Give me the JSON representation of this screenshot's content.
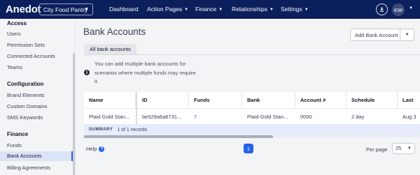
{
  "topbar": {
    "logo": "Anedot",
    "org_select": "City Food Pantry",
    "nav": [
      "Dashboard",
      "Action Pages",
      "Finance",
      "Relationships",
      "Settings"
    ],
    "avatar_initials": "KW"
  },
  "sidebar": {
    "sections": [
      {
        "heading": "Access",
        "items": [
          "Users",
          "Permission Sets",
          "Connected Accounts",
          "Teams"
        ]
      },
      {
        "heading": "Configuration",
        "items": [
          "Brand Elements",
          "Custom Domains",
          "SMS Keywords"
        ]
      },
      {
        "heading": "Finance",
        "items": [
          "Funds",
          "Bank Accounts",
          "Billing Agreements"
        ]
      }
    ],
    "active_item": "Bank Accounts"
  },
  "main": {
    "title": "Bank Accounts",
    "add_button": "Add Bank Account",
    "tab": "All bank accounts",
    "info": "You can add multiple bank accounts for scenarios where multiple funds may require it.",
    "table": {
      "columns": [
        "Name",
        "ID",
        "Funds",
        "Bank",
        "Account #",
        "Schedule",
        "Last"
      ],
      "rows": [
        [
          "Plaid Gold Stan...",
          "be529a6a6731...",
          "7",
          "Plaid Gold Stan...",
          "0000",
          "2 day",
          "Aug 3"
        ]
      ]
    },
    "summary_label": "SUMMARY",
    "summary_value": "1 of 1 records",
    "help": "Help",
    "page": "1",
    "per_page_label": "Per page",
    "per_page_value": "25"
  },
  "colors": {
    "topbar": "#0b1f5c",
    "accent": "#2563eb",
    "avatar": "#3a4a7a"
  }
}
